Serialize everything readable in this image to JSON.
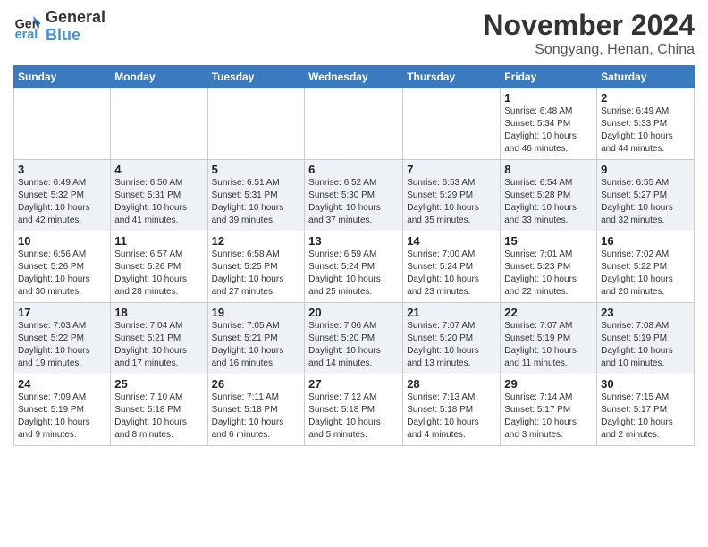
{
  "header": {
    "logo_line1": "General",
    "logo_line2": "Blue",
    "month": "November 2024",
    "location": "Songyang, Henan, China"
  },
  "weekdays": [
    "Sunday",
    "Monday",
    "Tuesday",
    "Wednesday",
    "Thursday",
    "Friday",
    "Saturday"
  ],
  "weeks": [
    [
      {
        "day": "",
        "info": ""
      },
      {
        "day": "",
        "info": ""
      },
      {
        "day": "",
        "info": ""
      },
      {
        "day": "",
        "info": ""
      },
      {
        "day": "",
        "info": ""
      },
      {
        "day": "1",
        "info": "Sunrise: 6:48 AM\nSunset: 5:34 PM\nDaylight: 10 hours\nand 46 minutes."
      },
      {
        "day": "2",
        "info": "Sunrise: 6:49 AM\nSunset: 5:33 PM\nDaylight: 10 hours\nand 44 minutes."
      }
    ],
    [
      {
        "day": "3",
        "info": "Sunrise: 6:49 AM\nSunset: 5:32 PM\nDaylight: 10 hours\nand 42 minutes."
      },
      {
        "day": "4",
        "info": "Sunrise: 6:50 AM\nSunset: 5:31 PM\nDaylight: 10 hours\nand 41 minutes."
      },
      {
        "day": "5",
        "info": "Sunrise: 6:51 AM\nSunset: 5:31 PM\nDaylight: 10 hours\nand 39 minutes."
      },
      {
        "day": "6",
        "info": "Sunrise: 6:52 AM\nSunset: 5:30 PM\nDaylight: 10 hours\nand 37 minutes."
      },
      {
        "day": "7",
        "info": "Sunrise: 6:53 AM\nSunset: 5:29 PM\nDaylight: 10 hours\nand 35 minutes."
      },
      {
        "day": "8",
        "info": "Sunrise: 6:54 AM\nSunset: 5:28 PM\nDaylight: 10 hours\nand 33 minutes."
      },
      {
        "day": "9",
        "info": "Sunrise: 6:55 AM\nSunset: 5:27 PM\nDaylight: 10 hours\nand 32 minutes."
      }
    ],
    [
      {
        "day": "10",
        "info": "Sunrise: 6:56 AM\nSunset: 5:26 PM\nDaylight: 10 hours\nand 30 minutes."
      },
      {
        "day": "11",
        "info": "Sunrise: 6:57 AM\nSunset: 5:26 PM\nDaylight: 10 hours\nand 28 minutes."
      },
      {
        "day": "12",
        "info": "Sunrise: 6:58 AM\nSunset: 5:25 PM\nDaylight: 10 hours\nand 27 minutes."
      },
      {
        "day": "13",
        "info": "Sunrise: 6:59 AM\nSunset: 5:24 PM\nDaylight: 10 hours\nand 25 minutes."
      },
      {
        "day": "14",
        "info": "Sunrise: 7:00 AM\nSunset: 5:24 PM\nDaylight: 10 hours\nand 23 minutes."
      },
      {
        "day": "15",
        "info": "Sunrise: 7:01 AM\nSunset: 5:23 PM\nDaylight: 10 hours\nand 22 minutes."
      },
      {
        "day": "16",
        "info": "Sunrise: 7:02 AM\nSunset: 5:22 PM\nDaylight: 10 hours\nand 20 minutes."
      }
    ],
    [
      {
        "day": "17",
        "info": "Sunrise: 7:03 AM\nSunset: 5:22 PM\nDaylight: 10 hours\nand 19 minutes."
      },
      {
        "day": "18",
        "info": "Sunrise: 7:04 AM\nSunset: 5:21 PM\nDaylight: 10 hours\nand 17 minutes."
      },
      {
        "day": "19",
        "info": "Sunrise: 7:05 AM\nSunset: 5:21 PM\nDaylight: 10 hours\nand 16 minutes."
      },
      {
        "day": "20",
        "info": "Sunrise: 7:06 AM\nSunset: 5:20 PM\nDaylight: 10 hours\nand 14 minutes."
      },
      {
        "day": "21",
        "info": "Sunrise: 7:07 AM\nSunset: 5:20 PM\nDaylight: 10 hours\nand 13 minutes."
      },
      {
        "day": "22",
        "info": "Sunrise: 7:07 AM\nSunset: 5:19 PM\nDaylight: 10 hours\nand 11 minutes."
      },
      {
        "day": "23",
        "info": "Sunrise: 7:08 AM\nSunset: 5:19 PM\nDaylight: 10 hours\nand 10 minutes."
      }
    ],
    [
      {
        "day": "24",
        "info": "Sunrise: 7:09 AM\nSunset: 5:19 PM\nDaylight: 10 hours\nand 9 minutes."
      },
      {
        "day": "25",
        "info": "Sunrise: 7:10 AM\nSunset: 5:18 PM\nDaylight: 10 hours\nand 8 minutes."
      },
      {
        "day": "26",
        "info": "Sunrise: 7:11 AM\nSunset: 5:18 PM\nDaylight: 10 hours\nand 6 minutes."
      },
      {
        "day": "27",
        "info": "Sunrise: 7:12 AM\nSunset: 5:18 PM\nDaylight: 10 hours\nand 5 minutes."
      },
      {
        "day": "28",
        "info": "Sunrise: 7:13 AM\nSunset: 5:18 PM\nDaylight: 10 hours\nand 4 minutes."
      },
      {
        "day": "29",
        "info": "Sunrise: 7:14 AM\nSunset: 5:17 PM\nDaylight: 10 hours\nand 3 minutes."
      },
      {
        "day": "30",
        "info": "Sunrise: 7:15 AM\nSunset: 5:17 PM\nDaylight: 10 hours\nand 2 minutes."
      }
    ]
  ]
}
